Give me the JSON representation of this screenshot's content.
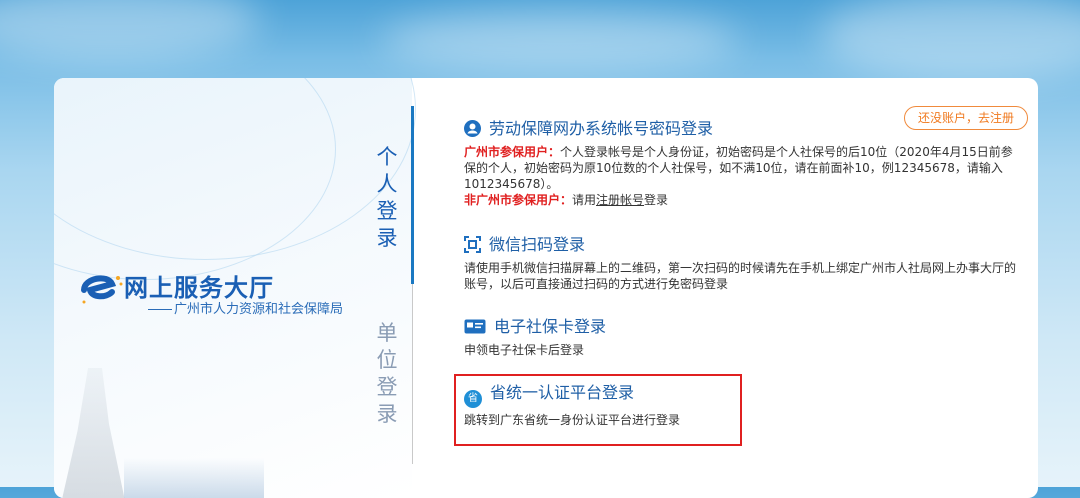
{
  "logo": {
    "title": "网上服务大厅",
    "subtitle": "广州市人力资源和社会保障局"
  },
  "tabs": {
    "personal": "个人登录",
    "unit": "单位登录"
  },
  "register": {
    "label": "还没账户，去注册"
  },
  "options": [
    {
      "title": "劳动保障网办系统帐号密码登录",
      "icon": "user-icon",
      "desc_red1": "广州市参保用户：",
      "desc_text1": "个人登录帐号是个人身份证，初始密码是个人社保号的后10位（2020年4月15日前参保的个人，初始密码为原10位数的个人社保号，如不满10位，请在前面补10，例12345678，请输入1012345678）。",
      "desc_red2": "非广州市参保用户：",
      "desc_text2a": "请用",
      "desc_link": "注册帐号",
      "desc_text2b": "登录"
    },
    {
      "title": "微信扫码登录",
      "icon": "qr-scan-icon",
      "desc": "请使用手机微信扫描屏幕上的二维码，第一次扫码的时候请先在手机上绑定广州市人社局网上办事大厅的账号，以后可直接通过扫码的方式进行免密码登录"
    },
    {
      "title": "电子社保卡登录",
      "icon": "card-icon",
      "desc": "申领电子社保卡后登录"
    },
    {
      "title": "省统一认证平台登录",
      "icon": "province-icon",
      "icon_text": "省",
      "desc": "跳转到广东省统一身份认证平台进行登录"
    }
  ],
  "colors": {
    "accent": "#1f5fa6",
    "highlight": "#e02020",
    "register": "#f07a20"
  }
}
